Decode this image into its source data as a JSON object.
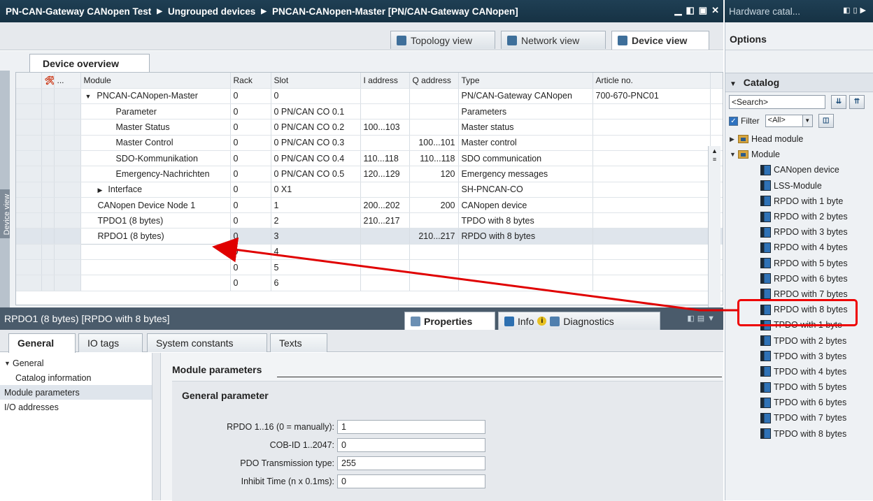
{
  "titlebar": {
    "crumbs": [
      "PN-CAN-Gateway CANopen Test",
      "Ungrouped devices",
      "PNCAN-CANopen-Master [PN/CAN-Gateway CANopen]"
    ],
    "separator": "▶"
  },
  "catalog_titlebar": {
    "title": "Hardware catal..."
  },
  "view_tabs": {
    "topology": "Topology view",
    "network": "Network view",
    "device": "Device view"
  },
  "device_overview": {
    "tab": "Device overview",
    "side_label": "Device view",
    "columns": [
      "...",
      "Module",
      "Rack",
      "Slot",
      "I address",
      "Q address",
      "Type",
      "Article no."
    ],
    "rows": [
      {
        "module": "PNCAN-CANopen-Master",
        "rack": "0",
        "slot": "0",
        "i": "",
        "q": "",
        "type": "PN/CAN-Gateway CANopen",
        "article": "700-670-PNC01",
        "level": 1,
        "expander": "▼"
      },
      {
        "module": "Parameter",
        "rack": "0",
        "slot": "0 PN/CAN CO 0.1",
        "i": "",
        "q": "",
        "type": "Parameters",
        "article": "",
        "level": 2
      },
      {
        "module": "Master Status",
        "rack": "0",
        "slot": "0 PN/CAN CO 0.2",
        "i": "100...103",
        "q": "",
        "type": "Master status",
        "article": "",
        "level": 2
      },
      {
        "module": "Master Control",
        "rack": "0",
        "slot": "0 PN/CAN CO 0.3",
        "i": "",
        "q": "100...101",
        "type": "Master control",
        "article": "",
        "level": 2
      },
      {
        "module": "SDO-Kommunikation",
        "rack": "0",
        "slot": "0 PN/CAN CO 0.4",
        "i": "110...118",
        "q": "110...118",
        "type": "SDO communication",
        "article": "",
        "level": 2
      },
      {
        "module": "Emergency-Nachrichten",
        "rack": "0",
        "slot": "0 PN/CAN CO 0.5",
        "i": "120...129",
        "q": "120",
        "type": "Emergency messages",
        "article": "",
        "level": 2
      },
      {
        "module": "Interface",
        "rack": "0",
        "slot": "0 X1",
        "i": "",
        "q": "",
        "type": "SH-PNCAN-CO",
        "article": "",
        "level": 2,
        "expander": "▶"
      },
      {
        "module": "CANopen Device Node 1",
        "rack": "0",
        "slot": "1",
        "i": "200...202",
        "q": "200",
        "type": "CANopen device",
        "article": "",
        "level": 1
      },
      {
        "module": "TPDO1 (8 bytes)",
        "rack": "0",
        "slot": "2",
        "i": "210...217",
        "q": "",
        "type": "TPDO with 8 bytes",
        "article": "",
        "level": 1
      },
      {
        "module": "RPDO1 (8 bytes)",
        "rack": "0",
        "slot": "3",
        "i": "",
        "q": "210...217",
        "type": "RPDO with 8 bytes",
        "article": "",
        "level": 1,
        "selected": true
      },
      {
        "module": "",
        "rack": "0",
        "slot": "4",
        "i": "",
        "q": "",
        "type": "",
        "article": "",
        "level": 1
      },
      {
        "module": "",
        "rack": "0",
        "slot": "5",
        "i": "",
        "q": "",
        "type": "",
        "article": "",
        "level": 1
      },
      {
        "module": "",
        "rack": "0",
        "slot": "6",
        "i": "",
        "q": "",
        "type": "",
        "article": "",
        "level": 1
      }
    ]
  },
  "inspector": {
    "title": "RPDO1 (8 bytes) [RPDO with 8 bytes]",
    "tabs": {
      "properties": "Properties",
      "info": "Info",
      "diagnostics": "Diagnostics"
    },
    "subtabs": [
      "General",
      "IO tags",
      "System constants",
      "Texts"
    ],
    "nav": [
      {
        "label": "General",
        "sub": false,
        "expander": "▼"
      },
      {
        "label": "Catalog information",
        "sub": true
      },
      {
        "label": "Module parameters",
        "sub": false,
        "selected": true
      },
      {
        "label": "I/O addresses",
        "sub": false
      }
    ],
    "section_title": "Module parameters",
    "group_title": "General parameter",
    "params": [
      {
        "label": "RPDO 1..16 (0 = manually):",
        "value": "1"
      },
      {
        "label": "COB-ID 1..2047:",
        "value": "0"
      },
      {
        "label": "PDO Transmission type:",
        "value": "255"
      },
      {
        "label": "Inhibit Time (n x 0.1ms):",
        "value": "0"
      }
    ]
  },
  "catalog": {
    "options": "Options",
    "header": "Catalog",
    "search_placeholder": "<Search>",
    "filter_label": "Filter",
    "filter_value": "<All>",
    "head_module": "Head module",
    "module_folder": "Module",
    "items": [
      "CANopen device",
      "LSS-Module",
      "RPDO with 1 byte",
      "RPDO with 2 bytes",
      "RPDO with 3 bytes",
      "RPDO with 4 bytes",
      "RPDO with 5 bytes",
      "RPDO with 6 bytes",
      "RPDO with 7 bytes",
      "RPDO with 8 bytes",
      "TPDO with 1 byte",
      "TPDO with 2 bytes",
      "TPDO with 3 bytes",
      "TPDO with 4 bytes",
      "TPDO with 5 bytes",
      "TPDO with 6 bytes",
      "TPDO with 7 bytes",
      "TPDO with 8 bytes"
    ],
    "highlighted_item": "RPDO with 8 bytes"
  },
  "colors": {
    "annotation": "#e00000",
    "titlebar": "#1f3f54",
    "selection": "#dfe5ec"
  }
}
